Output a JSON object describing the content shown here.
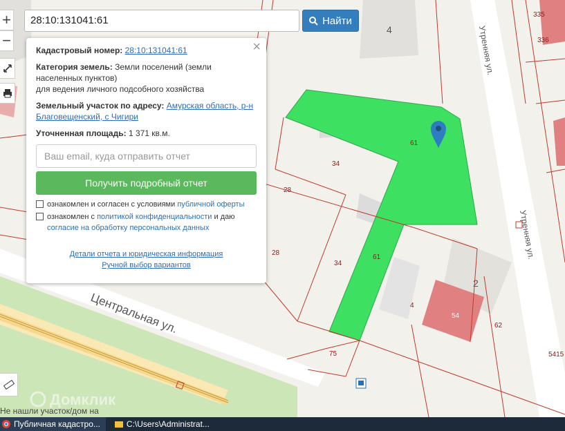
{
  "search": {
    "value": "28:10:131041:61",
    "button_label": "Найти"
  },
  "popup": {
    "cad_label": "Кадастровый номер:",
    "cad_value": "28:10:131041:61",
    "cat_label": "Категория земель:",
    "cat_value": "Земли поселений (земли населенных пунктов)",
    "cat_use": "для ведения личного подсобного хозяйства",
    "addr_label": "Земельный участок по адресу:",
    "addr_value": "Амурская область, р-н Благовещенский, с Чигири",
    "area_label": "Уточненная площадь:",
    "area_value": "1 371 кв.м.",
    "email_placeholder": "Ваш email, куда отправить отчет",
    "get_button": "Получить подробный отчет",
    "chk1_text": "ознакомлен и согласен с условиями ",
    "chk1_link": "публичной оферты",
    "chk2_text": "ознакомлен с ",
    "chk2_link": "политикой конфиденциальности",
    "chk2_tail": " и даю ",
    "chk2_link2": "согласие на обработку персональных данных",
    "details_link": "Детали отчета и юридическая информация",
    "manual_link": "Ручной выбор вариантов"
  },
  "map": {
    "streets": [
      "Центральная ул.",
      "Утренняя ул.",
      "Утренняя ул."
    ],
    "parcel_labels": [
      "61",
      "34",
      "28",
      "28",
      "34",
      "61",
      "4",
      "75",
      "2",
      "54",
      "62",
      "4",
      "335",
      "336",
      "5415"
    ],
    "watermark": "Домклик",
    "bottom_prompt": "Не нашли участок/дом на карте?",
    "colors": {
      "selected_parcel": "#3ee062",
      "buildings": "#dcdcdc",
      "red_parcels": "#e07a7a",
      "boundary": "#c0392b"
    }
  },
  "taskbar": {
    "item1": "Публичная кадастро...",
    "item2": "C:\\Users\\Administrat..."
  }
}
